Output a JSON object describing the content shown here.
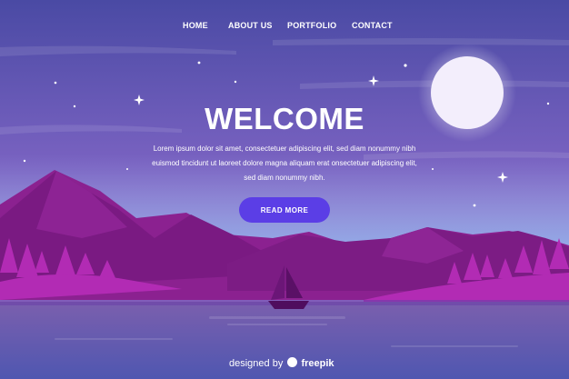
{
  "nav": {
    "items": [
      "HOME",
      "ABOUT US",
      "PORTFOLIO",
      "CONTACT"
    ]
  },
  "hero": {
    "title": "WELCOME",
    "body_lines": [
      "Lorem ipsum dolor sit amet, consectetuer adipiscing elit, sed diam nonummy nibh",
      "euismod tincidunt ut laoreet dolore magna aliquam erat onsectetuer adipiscing elit,",
      "sed diam nonummy nibh."
    ],
    "button_label": "READ MORE"
  },
  "footer": {
    "credit_prefix": "designed by",
    "credit_brand": "freepik"
  },
  "colors": {
    "sky_top": "#4b4aa6",
    "sky_bottom": "#b48ad8",
    "moon": "#f4eefc",
    "mountain_back": "#8a1f8a",
    "mountain_front": "#6e1476",
    "trees": "#b02ab3",
    "water": "#6a5aa8",
    "button": "#5b3ee6",
    "text": "#ffffff"
  },
  "icons": [
    "moon-icon",
    "star-icon",
    "sailboat-icon",
    "freepik-logo-icon"
  ]
}
